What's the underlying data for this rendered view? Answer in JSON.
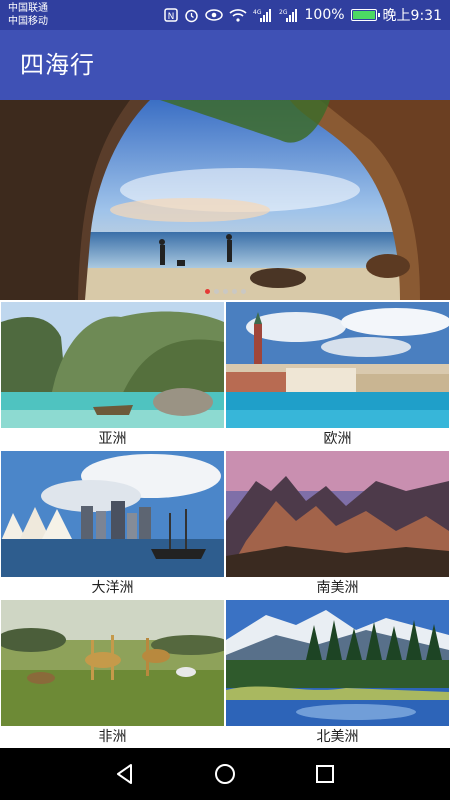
{
  "status": {
    "carrier1": "中国联通",
    "carrier2": "中国移动",
    "nfc": "N",
    "signal1": "4G",
    "signal2": "2G",
    "battery_text": "100%",
    "battery_level": 1.0,
    "time": "晚上9:31"
  },
  "appbar": {
    "title": "四海行"
  },
  "banner": {
    "page_count": 5,
    "active_index": 0
  },
  "regions": [
    {
      "label": "亚洲"
    },
    {
      "label": "欧洲"
    },
    {
      "label": "大洋洲"
    },
    {
      "label": "南美洲"
    },
    {
      "label": "非洲"
    },
    {
      "label": "北美洲"
    }
  ],
  "nav": {
    "back": "back-icon",
    "home": "home-icon",
    "recents": "recents-icon"
  },
  "colors": {
    "status_bar": "#303f9f",
    "app_bar": "#3f51b5",
    "dot_active": "#e53935"
  }
}
